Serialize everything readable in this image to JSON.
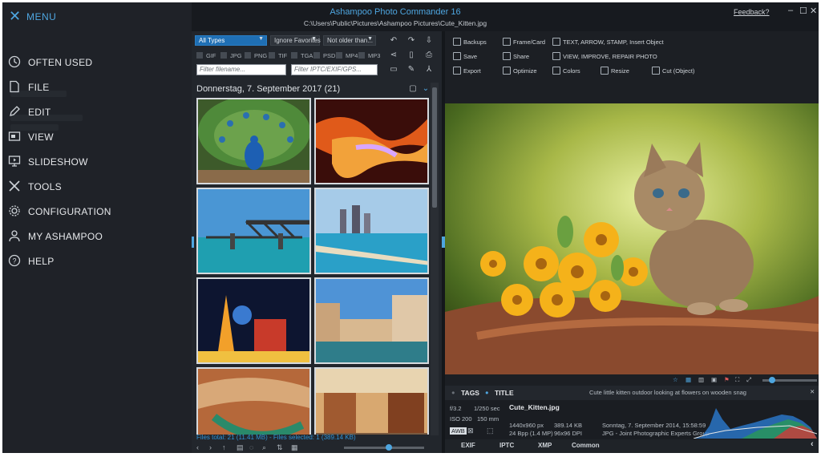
{
  "window": {
    "title": "Ashampoo Photo Commander 16",
    "path": "C:\\Users\\Public\\Pictures\\Ashampoo Pictures\\Cute_Kitten.jpg",
    "feedback": "Feedback?",
    "controls": [
      "–",
      "☐",
      "✕"
    ]
  },
  "menu": {
    "header": "MENU",
    "items": [
      {
        "label": "OFTEN USED",
        "icon": "clock-icon"
      },
      {
        "label": "FILE",
        "icon": "file-icon"
      },
      {
        "label": "EDIT",
        "icon": "pencil-icon"
      },
      {
        "label": "VIEW",
        "icon": "view-icon"
      },
      {
        "label": "SLIDESHOW",
        "icon": "slideshow-icon"
      },
      {
        "label": "TOOLS",
        "icon": "tools-icon"
      },
      {
        "label": "CONFIGURATION",
        "icon": "gear-icon"
      },
      {
        "label": "MY ASHAMPOO",
        "icon": "user-icon"
      },
      {
        "label": "HELP",
        "icon": "help-icon"
      }
    ]
  },
  "filters": {
    "type": "All Types",
    "favorites": "Ignore Favorites",
    "age": "Not older than...",
    "formats": [
      "GIF",
      "JPG",
      "PNG",
      "TIF",
      "TGA",
      "PSD",
      "MP4",
      "MP3"
    ],
    "filename_placeholder": "Filter filename...",
    "iptc_placeholder": "Filter IPTC/EXIF/GPS..."
  },
  "browser": {
    "date_header": "Donnerstag, 7. September 2017 (21)",
    "status": "Files total: 21 (11.41 MB) - Files selected: 1 (389.14 KB)",
    "thumbnails": [
      "Peacock",
      "Antelope Canyon",
      "Bridge",
      "Skyline beach",
      "Las Vegas night",
      "Venice canal",
      "Canyon river",
      "Market street"
    ]
  },
  "tools": {
    "row1": [
      "Backups",
      "Frame/Card",
      "TEXT, ARROW, STAMP, Insert Object"
    ],
    "row2": [
      "Save",
      "Share",
      "VIEW, IMPROVE, REPAIR PHOTO"
    ],
    "row3": [
      "Export",
      "Optimize",
      "Colors",
      "Resize",
      "Cut (Object)"
    ]
  },
  "tagbar": {
    "tags": "TAGS",
    "title_label": "TITLE",
    "title_value": "Cute little kitten outdoor looking at flowers on wooden snag"
  },
  "info": {
    "aperture": "f/3.2",
    "shutter": "1/250 sec",
    "iso": "ISO 200",
    "focal": "150 mm",
    "filename": "Cute_Kitten.jpg",
    "dims": "1440x960 px",
    "filesize": "389.14 KB",
    "bpp": "24 Bpp (1.4 MP)",
    "dpi": "96x96 DPI",
    "date": "Sonntag, 7. September 2014, 15:58:59",
    "format": "JPG - Joint Photographic Experts Group",
    "awb": "AWB"
  },
  "tabs": [
    "EXIF",
    "IPTC",
    "XMP",
    "Common"
  ],
  "colors": {
    "accent": "#4ea6e0",
    "status": "#2f93d6"
  }
}
